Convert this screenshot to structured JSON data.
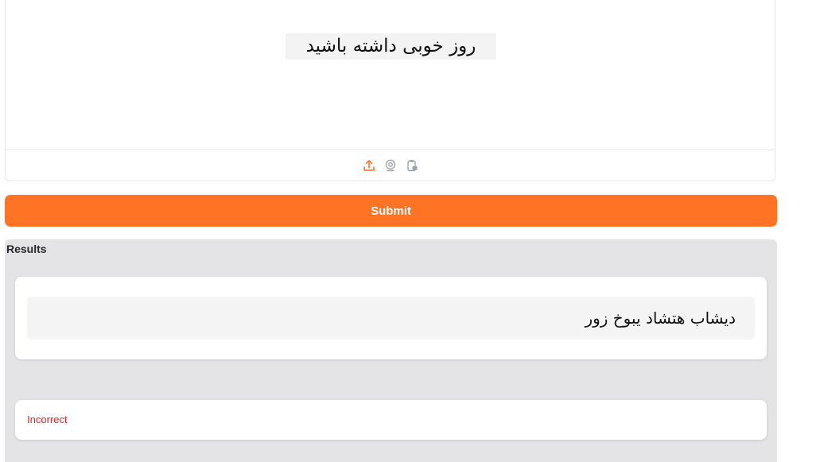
{
  "input": {
    "image_text": "روز خوبی داشته باشید",
    "tools": [
      {
        "icon": "upload-icon"
      },
      {
        "icon": "webcam-icon"
      },
      {
        "icon": "clipboard-icon"
      }
    ]
  },
  "submit_label": "Submit",
  "results": {
    "label": "Results",
    "output_text": "دیشاب هتشاد یبوخ زور",
    "status": "Incorrect"
  },
  "colors": {
    "accent": "#ff7424",
    "error": "#dc2626",
    "panel_bg": "#e4e4e7"
  }
}
